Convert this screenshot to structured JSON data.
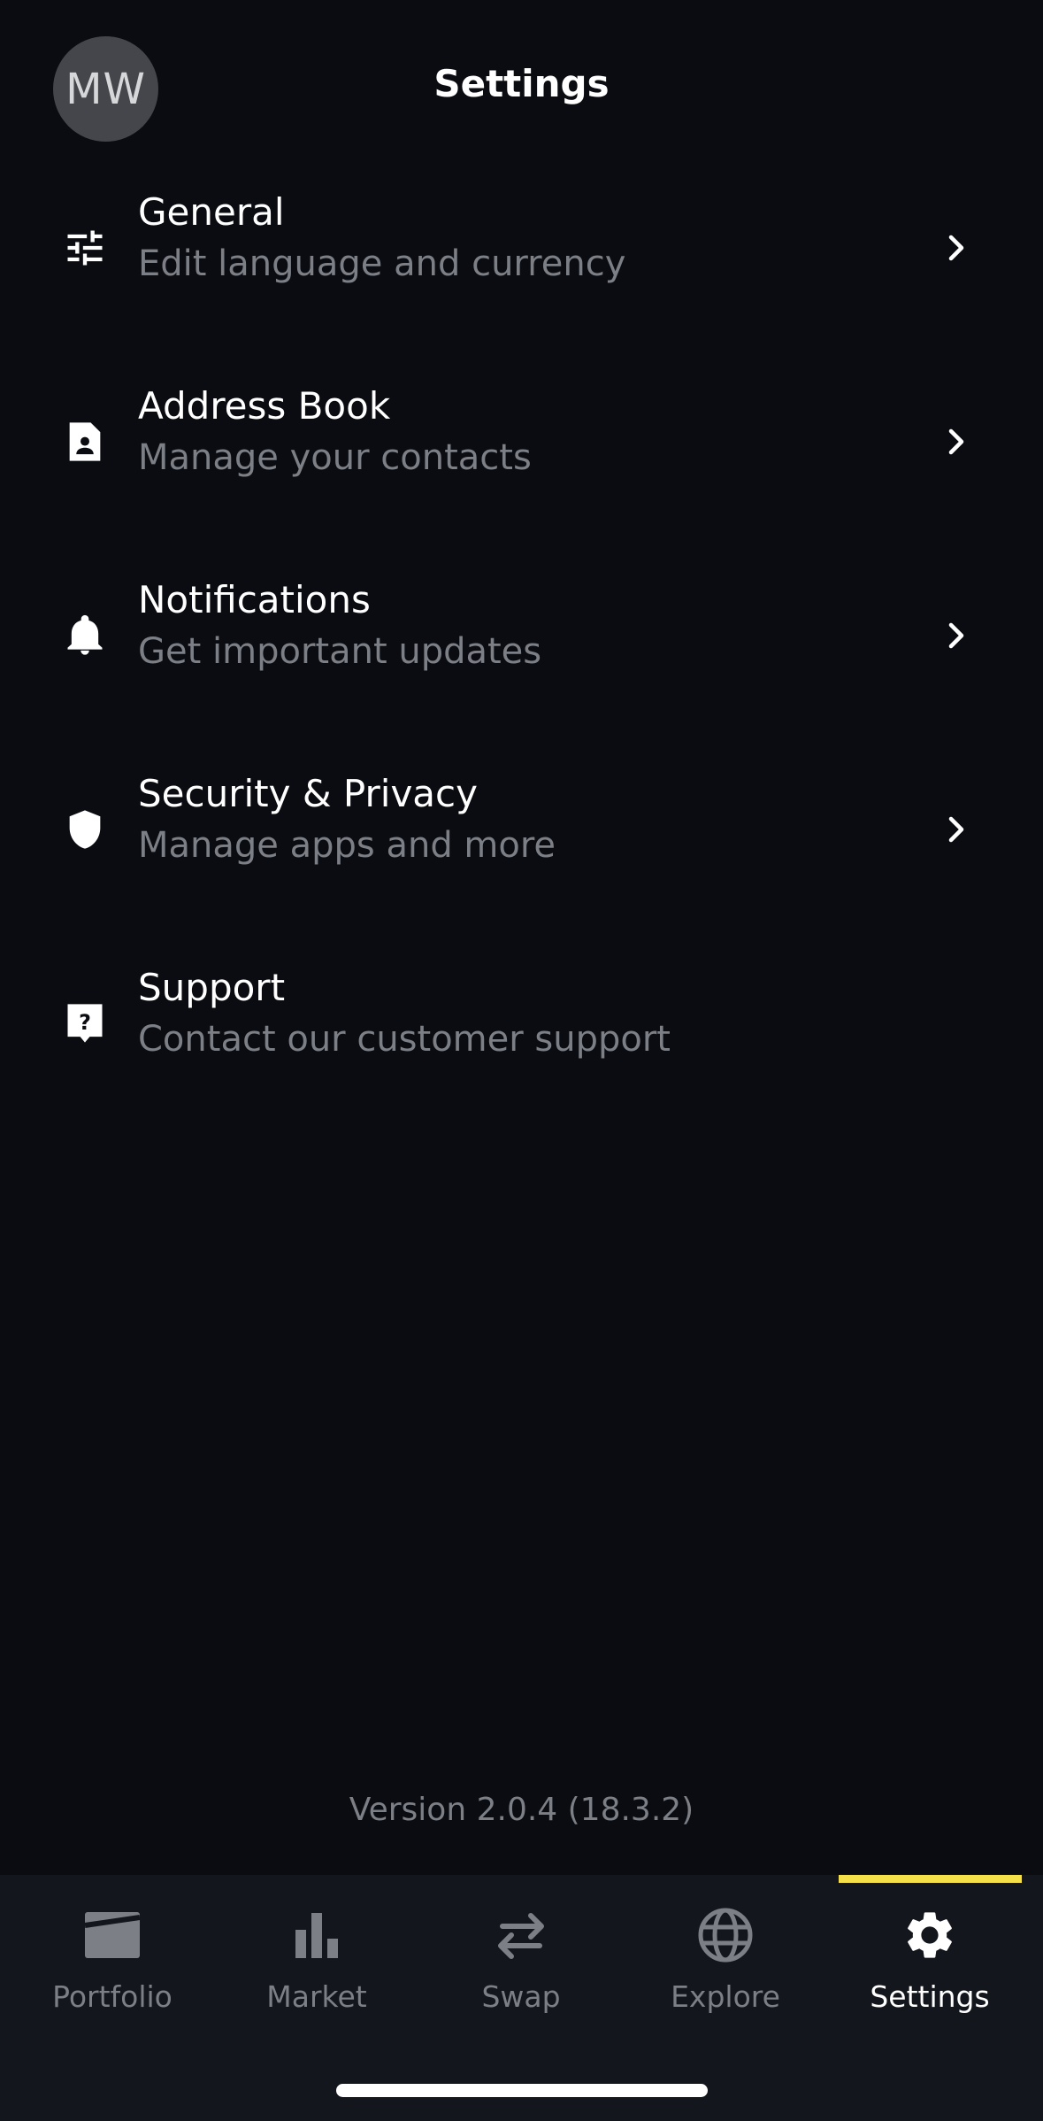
{
  "header": {
    "avatar_initials": "MW",
    "title": "Settings"
  },
  "menu": [
    {
      "title": "General",
      "subtitle": "Edit language and currency",
      "icon": "sliders-icon",
      "has_chevron": true
    },
    {
      "title": "Address Book",
      "subtitle": "Manage your contacts",
      "icon": "contact-card-icon",
      "has_chevron": true
    },
    {
      "title": "Notifications",
      "subtitle": "Get important updates",
      "icon": "bell-icon",
      "has_chevron": true
    },
    {
      "title": "Security & Privacy",
      "subtitle": "Manage apps and more",
      "icon": "shield-icon",
      "has_chevron": true
    },
    {
      "title": "Support",
      "subtitle": "Contact our customer support",
      "icon": "help-chat-icon",
      "has_chevron": false
    }
  ],
  "version": "Version 2.0.4 (18.3.2)",
  "bottom_nav": {
    "items": [
      {
        "label": "Portfolio",
        "icon": "wallet-icon",
        "active": false
      },
      {
        "label": "Market",
        "icon": "bar-chart-icon",
        "active": false
      },
      {
        "label": "Swap",
        "icon": "swap-arrows-icon",
        "active": false
      },
      {
        "label": "Explore",
        "icon": "globe-icon",
        "active": false
      },
      {
        "label": "Settings",
        "icon": "gear-icon",
        "active": true
      }
    ]
  },
  "colors": {
    "background": "#0a0c12",
    "nav_background": "#14161d",
    "accent": "#f5e04a",
    "muted_text": "#7c7f86"
  }
}
